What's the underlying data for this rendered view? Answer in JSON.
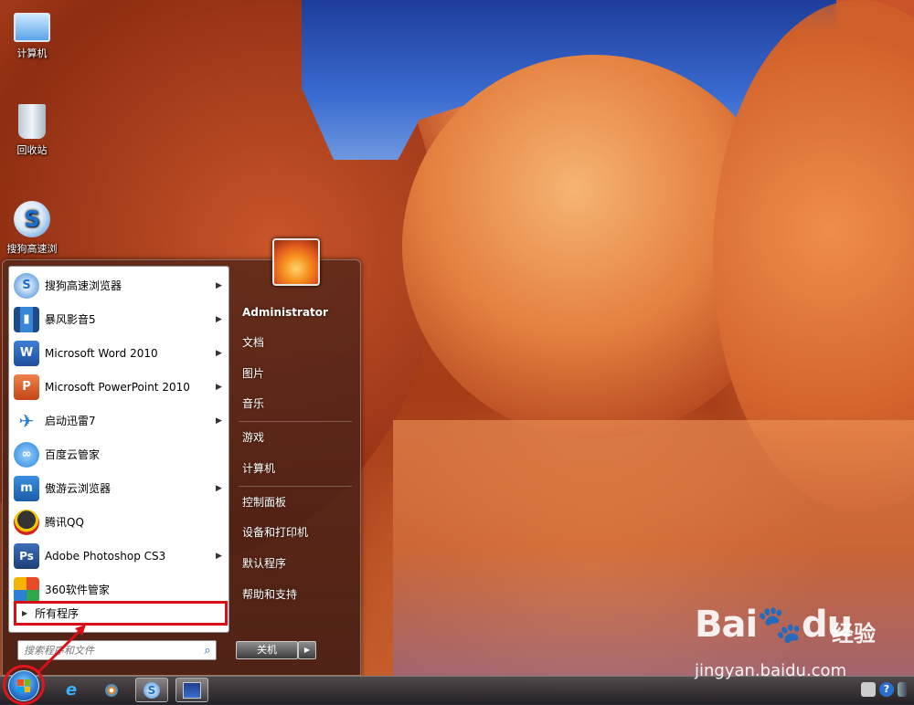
{
  "desktop": {
    "icons": [
      {
        "label": "计算机",
        "icon": "computer-icon"
      },
      {
        "label": "回收站",
        "icon": "recycle-bin-icon"
      },
      {
        "label": "搜狗高速浏",
        "icon": "sogou-browser-icon"
      }
    ]
  },
  "start_menu": {
    "programs": [
      {
        "label": "搜狗高速浏览器",
        "icon": "sogou-browser-icon",
        "has_submenu": true
      },
      {
        "label": "暴风影音5",
        "icon": "baofeng-icon",
        "has_submenu": true
      },
      {
        "label": "Microsoft Word 2010",
        "icon": "word-icon",
        "has_submenu": true
      },
      {
        "label": "Microsoft PowerPoint 2010",
        "icon": "powerpoint-icon",
        "has_submenu": true
      },
      {
        "label": "启动迅雷7",
        "icon": "thunder-icon",
        "has_submenu": true
      },
      {
        "label": "百度云管家",
        "icon": "baidu-cloud-icon",
        "has_submenu": false
      },
      {
        "label": "傲游云浏览器",
        "icon": "maxthon-icon",
        "has_submenu": true
      },
      {
        "label": "腾讯QQ",
        "icon": "qq-icon",
        "has_submenu": false
      },
      {
        "label": "Adobe Photoshop CS3",
        "icon": "photoshop-icon",
        "has_submenu": true
      },
      {
        "label": "360软件管家",
        "icon": "360-icon",
        "has_submenu": false
      }
    ],
    "all_programs": "所有程序",
    "search_placeholder": "搜索程序和文件",
    "right_links": {
      "user": "Administrator",
      "documents": "文档",
      "pictures": "图片",
      "music": "音乐",
      "games": "游戏",
      "computer": "计算机",
      "control_panel": "控制面板",
      "devices_printers": "设备和打印机",
      "default_programs": "默认程序",
      "help": "帮助和支持"
    },
    "shutdown_label": "关机"
  },
  "watermark": {
    "logo_text": "Bai",
    "logo_text2": "du",
    "cn_text": "经验",
    "url": "jingyan.baidu.com"
  },
  "colors": {
    "highlight_red": "#d90f18",
    "menu_bg": "#5a2819"
  }
}
